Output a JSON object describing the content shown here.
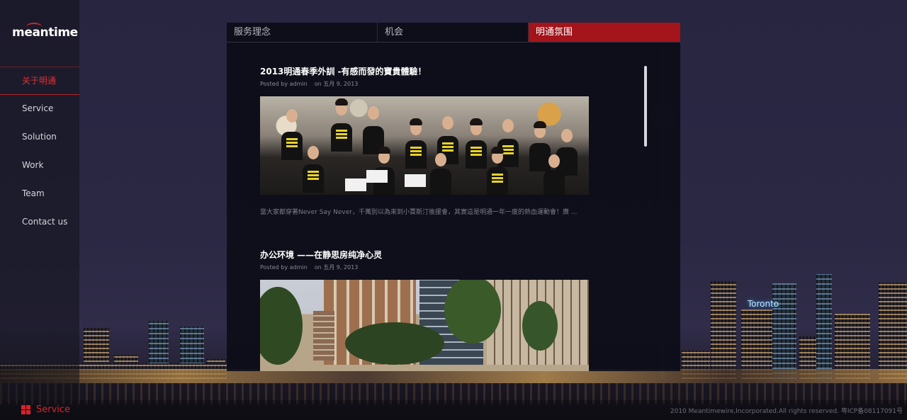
{
  "brand": {
    "logo_text": "meantime"
  },
  "sidebar": {
    "items": [
      {
        "label": "关于明通",
        "active": true
      },
      {
        "label": "Service"
      },
      {
        "label": "Solution"
      },
      {
        "label": "Work"
      },
      {
        "label": "Team"
      },
      {
        "label": "Contact us"
      }
    ]
  },
  "tabs": [
    {
      "label": "服务理念"
    },
    {
      "label": "机会"
    },
    {
      "label": "明通氛围",
      "active": true
    }
  ],
  "posts": [
    {
      "title": "2013明通春季外訓 -有感而發的寶貴體驗！",
      "posted_by": "Posted by admin",
      "date": "on 五月 9, 2013",
      "excerpt": "當大家都穿著Never Say Never，千萬別以為來到小賈斯汀後援會，其實這是明通一年一度的熱血運動會！廣 ..."
    },
    {
      "title": "办公环境 ——在静思房纯净心灵",
      "posted_by": "Posted by admin",
      "date": "on 五月 9, 2013"
    }
  ],
  "background": {
    "city_sign": "Toronto"
  },
  "footer": {
    "section_label": "Service",
    "copyright": "2010 Meantimewire,Incorporated.All rights reserved. 粤ICP备08117091号"
  },
  "colors": {
    "accent": "#a3141b",
    "accent_text": "#d8222a",
    "panel_bg": "#0b0c16"
  }
}
